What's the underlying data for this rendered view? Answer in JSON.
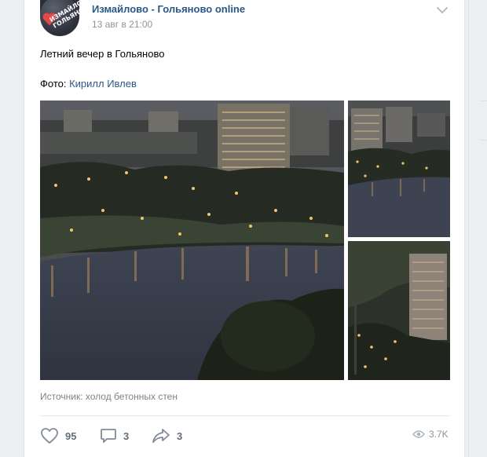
{
  "post": {
    "author": "Измайлово - Гольяново online",
    "date": "13 авг в 21:00",
    "text": "Летний вечер в Гольяново",
    "photo_credit_prefix": "Фото: ",
    "photo_credit_name": "Кирилл Ивлев",
    "source": "Источник: холод бетонных стен",
    "avatar_text": "ИЗМАЙЛОВО ГОЛЬЯНОВО"
  },
  "actions": {
    "likes": "95",
    "comments": "3",
    "shares": "3",
    "views": "3.7K"
  },
  "icons": {
    "like": "heart-icon",
    "comment": "comment-icon",
    "share": "share-icon",
    "views": "eye-icon",
    "menu": "chevron-down-icon"
  },
  "colors": {
    "link": "#2a5885",
    "action_gray": "#626d7a",
    "meta_gray": "#939393"
  }
}
